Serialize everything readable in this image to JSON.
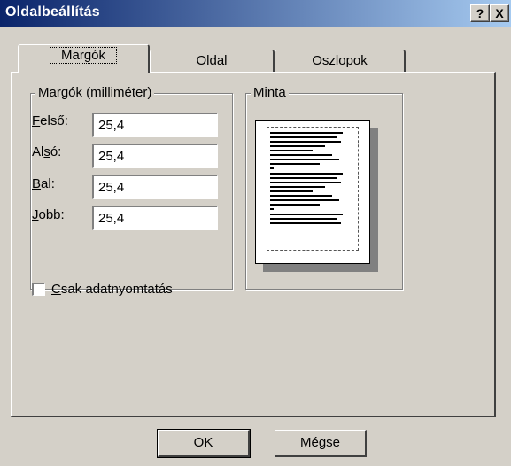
{
  "window": {
    "title": "Oldalbeállítás",
    "help_label": "?",
    "close_label": "X"
  },
  "tabs": [
    {
      "label": "Margók",
      "active": true
    },
    {
      "label": "Oldal",
      "active": false
    },
    {
      "label": "Oszlopok",
      "active": false
    }
  ],
  "margins_group": {
    "title": "Margók (milliméter)",
    "fields": [
      {
        "accel": "F",
        "rest": "első:",
        "value": "25,4"
      },
      {
        "accel_prefix": "Al",
        "accel": "s",
        "rest": "ó:",
        "value": "25,4"
      },
      {
        "accel": "B",
        "rest": "al:",
        "value": "25,4"
      },
      {
        "accel": "J",
        "rest": "obb:",
        "value": "25,4"
      }
    ]
  },
  "preview_group": {
    "title": "Minta"
  },
  "data_only": {
    "accel": "C",
    "rest": "sak adatnyomtatás",
    "checked": false
  },
  "buttons": {
    "ok": "OK",
    "cancel": "Mégse"
  }
}
